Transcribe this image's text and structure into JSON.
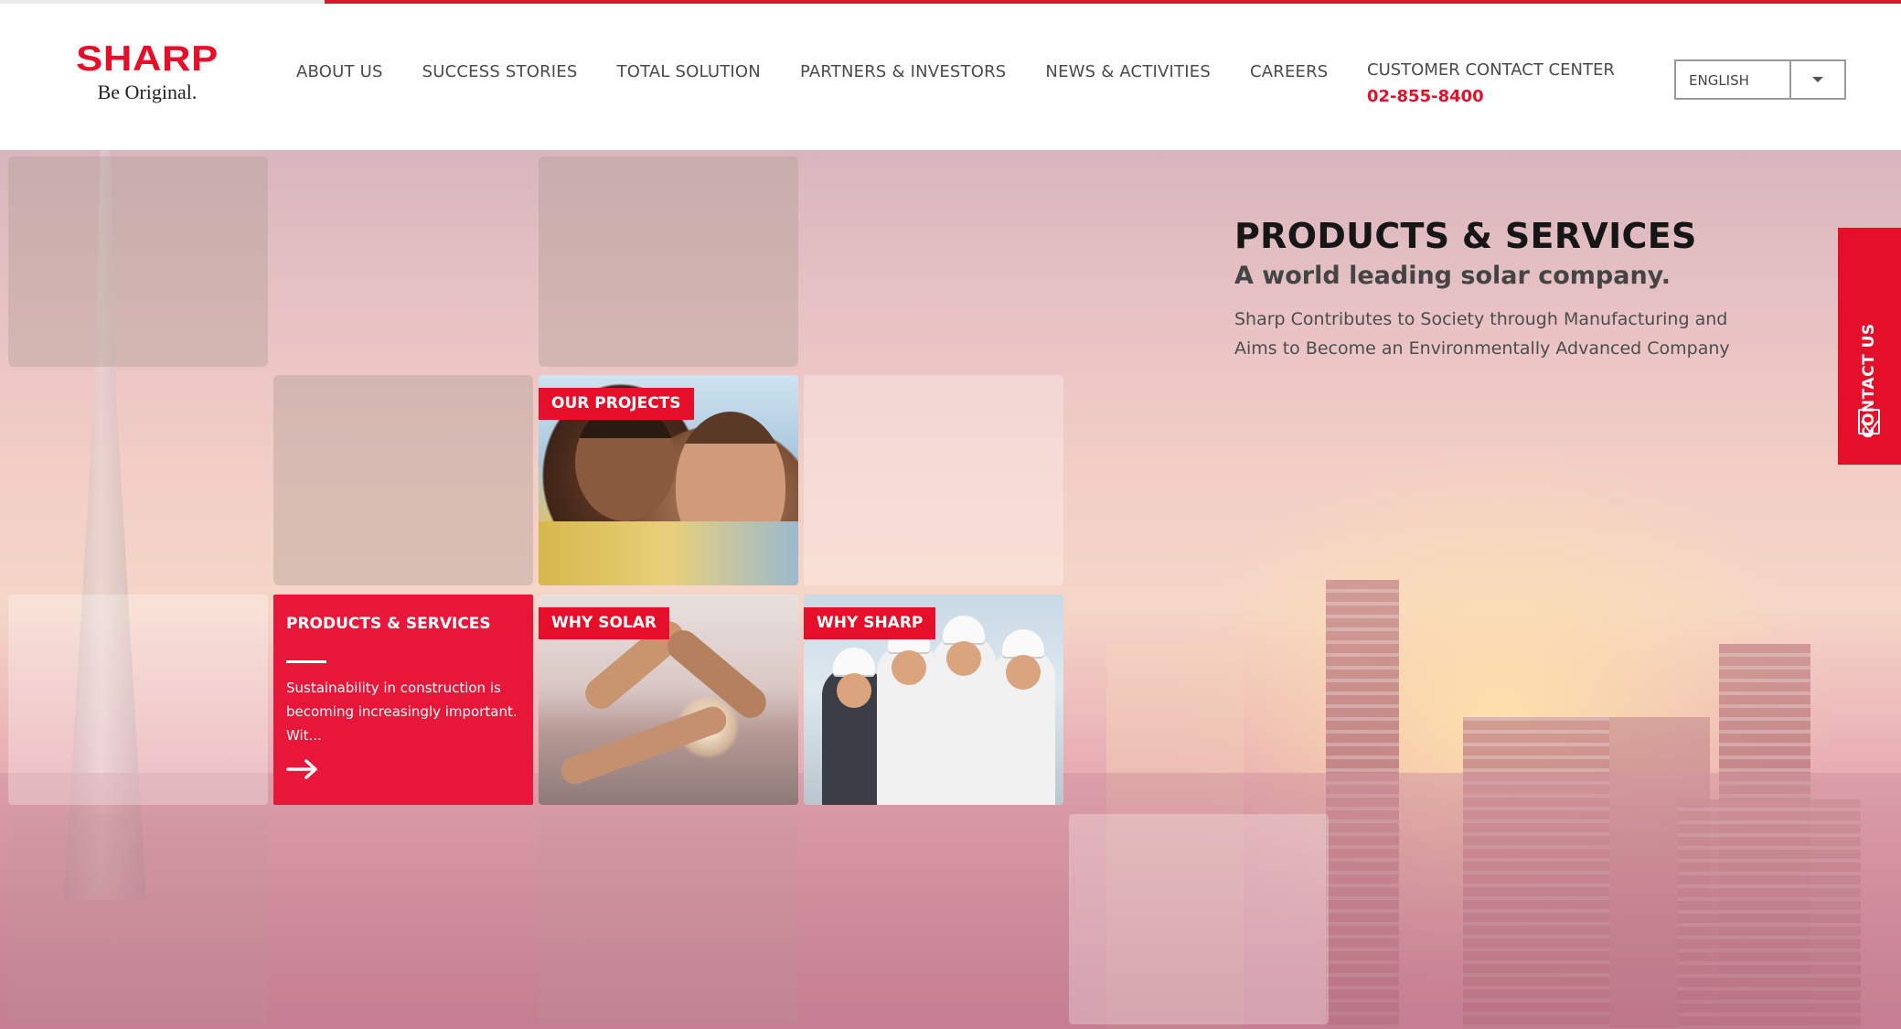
{
  "brand": {
    "name": "SHARP",
    "tagline": "Be Original."
  },
  "nav": {
    "items": [
      {
        "label": "ABOUT US"
      },
      {
        "label": "SUCCESS STORIES"
      },
      {
        "label": "TOTAL SOLUTION"
      },
      {
        "label": "PARTNERS & INVESTORS"
      },
      {
        "label": "NEWS & ACTIVITIES"
      },
      {
        "label": "CAREERS"
      }
    ]
  },
  "contact_center": {
    "label": "CUSTOMER CONTACT CENTER",
    "phone": "02-855-8400"
  },
  "language": {
    "selected": "ENGLISH"
  },
  "tiles": {
    "our_projects": {
      "tag": "OUR PROJECTS"
    },
    "products_services": {
      "title": "PRODUCTS & SERVICES",
      "description": "Sustainability in construction is becoming increasingly important. Wit..."
    },
    "why_solar": {
      "tag": "WHY SOLAR"
    },
    "why_sharp": {
      "tag": "WHY SHARP"
    }
  },
  "hero": {
    "title": "PRODUCTS & SERVICES",
    "subtitle": "A world leading solar company.",
    "description": "Sharp Contributes to Society through Manufacturing and Aims to Become an Environmentally Advanced Company"
  },
  "contact_tab": {
    "label": "CONTACT US",
    "icon": "mail-icon"
  },
  "colors": {
    "brand_red": "#e60f2a",
    "tile_red": "#e8173a"
  }
}
